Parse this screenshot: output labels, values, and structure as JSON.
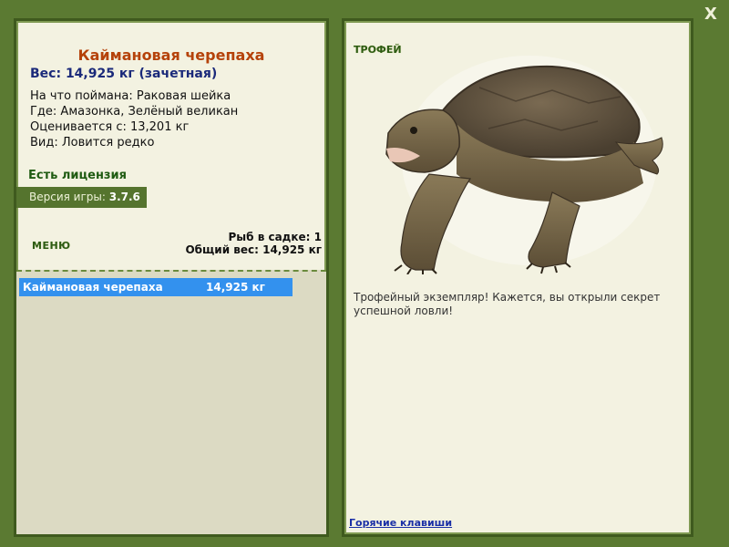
{
  "close_label": "X",
  "fish": {
    "title": "Каймановая черепаха",
    "weight_line": "Вес: 14,925 кг (зачетная)",
    "info": [
      "На что поймана: Раковая шейка",
      "Где: Амазонка, Зелёный великан",
      "Оценивается с: 13,201 кг",
      "Вид: Ловится редко"
    ]
  },
  "license": "Есть лицензия",
  "version": {
    "label": "Версия игры:",
    "value": "3.7.6"
  },
  "menu_label": "МЕНЮ",
  "keepnet": {
    "count_line": "Рыб в садке: 1",
    "total_line": "Общий вес: 14,925 кг"
  },
  "catch_list": [
    {
      "name": "Каймановая черепаха",
      "weight": "14,925 кг"
    }
  ],
  "trophy_label": "ТРОФЕЙ",
  "description": "Трофейный экземпляр! Кажется, вы открыли секрет успешной ловли!",
  "hotkeys_link": "Горячие клавиши",
  "colors": {
    "background": "#5b7a32",
    "panel": "#f3f2e1",
    "title": "#b5420a",
    "weight": "#1b2a7a",
    "selected_row": "#3391ee"
  }
}
